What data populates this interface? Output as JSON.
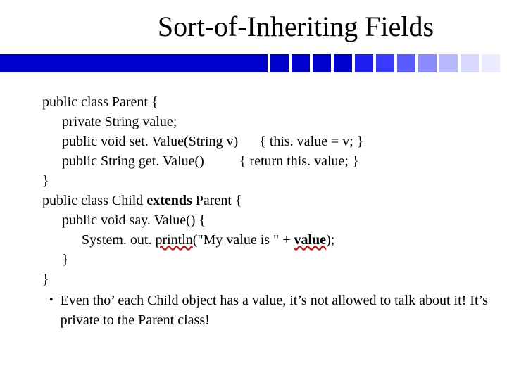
{
  "title": "Sort-of-Inheriting Fields",
  "code": {
    "l1": "public class Parent {",
    "l2": "private String value;",
    "l3a": "public void set. Value(String v)",
    "l3b": "{ this. value = v; }",
    "l4a": "public String get. Value()",
    "l4b": "{ return this. value; }",
    "l5": "}",
    "l6a": "public class Child ",
    "l6b": "extends",
    "l6c": " Parent {",
    "l7": "public void say. Value() {",
    "l8a": "System. out. ",
    "l8b": "println",
    "l8c": "(\"My value is \" + ",
    "l8d": "value",
    "l8e": ");",
    "l9": "}",
    "l10": "}"
  },
  "bullet": "Even tho’ each Child object has a value, it’s not allowed to talk about it!  It’s private to the Parent class!",
  "colors": {
    "bar": "#0000cc",
    "sq": [
      "#0000cc",
      "#0000cc",
      "#0000cc",
      "#0000cc",
      "#1e1ef0",
      "#3a3aff",
      "#5a5aff",
      "#8a8aff",
      "#b8b8ff",
      "#d8d8ff",
      "#ececff"
    ]
  }
}
